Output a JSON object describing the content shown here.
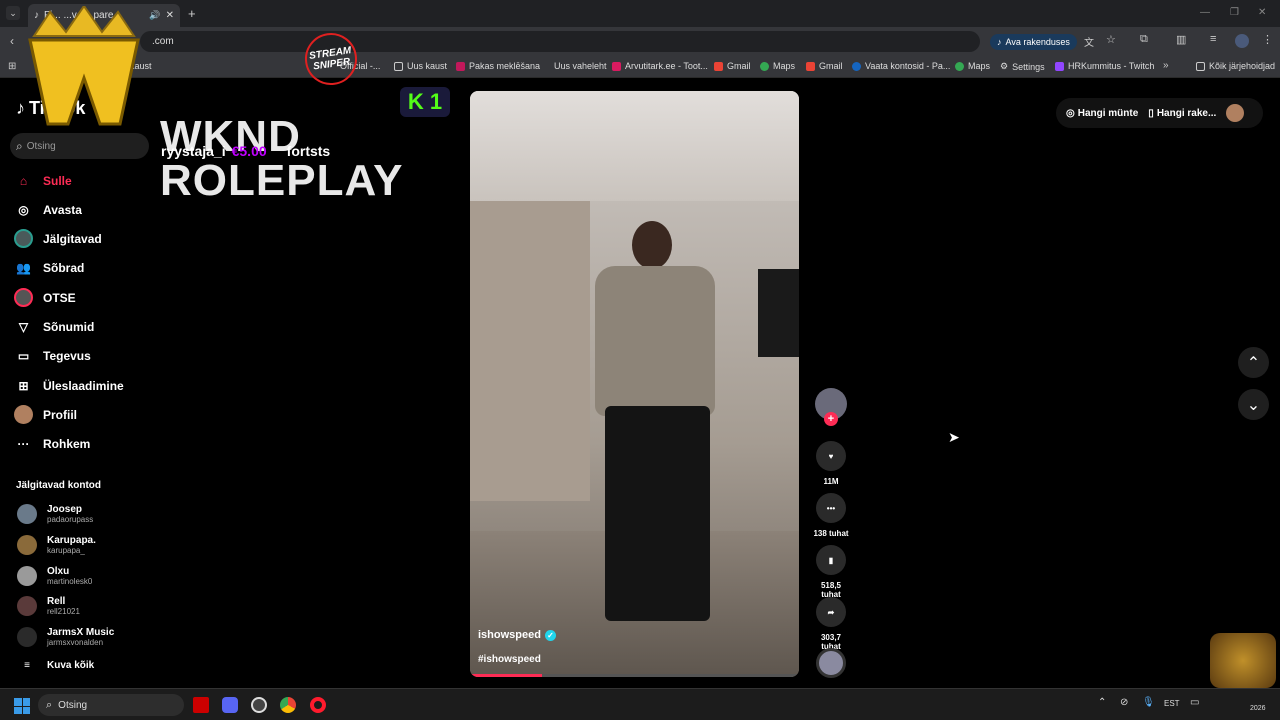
{
  "browser": {
    "tab_title": "Fi... ...ve... pare",
    "url_fragment": ".com",
    "open_app_button": "Ava rakenduses",
    "bookmarks": [
      {
        "label": "kaust",
        "icon": "folder-icon"
      },
      {
        "label": "Official -...",
        "icon": "page-icon"
      },
      {
        "label": "Uus kaust",
        "icon": "folder-icon"
      },
      {
        "label": "Pakas meklēšana",
        "icon": "page-icon"
      },
      {
        "label": "Uus vaheleht",
        "icon": "page-icon"
      },
      {
        "label": "Arvutitark.ee - Toot...",
        "icon": "page-icon"
      },
      {
        "label": "Gmail",
        "icon": "gmail-icon"
      },
      {
        "label": "Maps",
        "icon": "maps-icon"
      },
      {
        "label": "Gmail",
        "icon": "gmail-icon"
      },
      {
        "label": "Vaata kontosid - Pa...",
        "icon": "page-icon"
      },
      {
        "label": "Maps",
        "icon": "maps-icon"
      },
      {
        "label": "Settings",
        "icon": "gear-icon"
      },
      {
        "label": "HRKummitus - Twitch",
        "icon": "twitch-icon"
      }
    ],
    "all_bookmarks": "Kõik järjehoidjad"
  },
  "overlay": {
    "title_line1": "WKND",
    "title_line2": "ROLEPLAY",
    "badge": "STREAM SNIPER",
    "k_badge": "1",
    "donor": "ryystaja_i",
    "amount": "€5.00",
    "message": "fortsts"
  },
  "tiktok": {
    "logo": "TikTok",
    "search_placeholder": "Otsing",
    "nav": [
      {
        "label": "Sulle",
        "icon": "home-icon"
      },
      {
        "label": "Avasta",
        "icon": "compass-icon"
      },
      {
        "label": "Jälgitavad",
        "icon": "following-icon"
      },
      {
        "label": "Sõbrad",
        "icon": "friends-icon"
      },
      {
        "label": "OTSE",
        "icon": "live-icon"
      },
      {
        "label": "Sõnumid",
        "icon": "messages-icon"
      },
      {
        "label": "Tegevus",
        "icon": "activity-icon"
      },
      {
        "label": "Üleslaadimine",
        "icon": "upload-icon"
      },
      {
        "label": "Profiil",
        "icon": "profile-icon"
      },
      {
        "label": "Rohkem",
        "icon": "more-icon"
      }
    ],
    "following_header": "Jälgitavad kontod",
    "following": [
      {
        "name": "Joosep",
        "handle": "padaorupass"
      },
      {
        "name": "Karupapa.",
        "handle": "karupapa_"
      },
      {
        "name": "Olxu",
        "handle": "martinolesk0"
      },
      {
        "name": "Rell",
        "handle": "rell21021"
      },
      {
        "name": "JarmsX Music",
        "handle": "jarmsxvonalden"
      }
    ],
    "see_all": "Kuva kõik",
    "top_right": {
      "coins": "Hangi münte",
      "app": "Hangi rake..."
    },
    "video": {
      "author": "ishowspeed",
      "hashtag": "#ishowspeed",
      "progress": 0.22
    },
    "actions": {
      "likes": "11M",
      "comments": "138 tuhat",
      "saves": "518,5 tuhat",
      "shares": "303,7 tuhat"
    }
  },
  "taskbar": {
    "search": "Otsing",
    "lang": "EST",
    "year": "2026"
  },
  "colors": {
    "tiktok_red": "#fe2c55",
    "accent_blue": "#1a73e8",
    "amount_purple": "#c000ff"
  }
}
